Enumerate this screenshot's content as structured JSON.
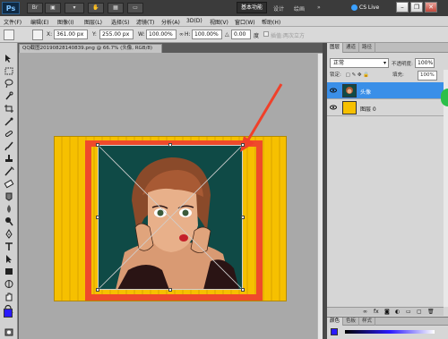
{
  "app": {
    "logo": "Ps",
    "workspace_active": "基本功能",
    "workspace_items": [
      "设计",
      "绘画"
    ],
    "cs_live": "CS Live"
  },
  "menu": [
    "文件(F)",
    "编辑(E)",
    "图像(I)",
    "图层(L)",
    "选择(S)",
    "滤镜(T)",
    "分析(A)",
    "3D(D)",
    "视图(V)",
    "窗口(W)",
    "帮助(H)"
  ],
  "options": {
    "x_label": "X:",
    "x_value": "361.00 px",
    "y_label": "Y:",
    "y_value": "255.00 px",
    "w_label": "W:",
    "w_value": "100.00%",
    "h_label": "H:",
    "h_value": "100.00%",
    "angle_label": "△",
    "angle_value": "0.00",
    "degree": "度",
    "interpolation_label": "插值:两次立方"
  },
  "document": {
    "tab_title": "QQ截图20190828140839.png @ 66.7% (头像, RGB/8)"
  },
  "colors": {
    "foreground": "#2a1aff",
    "background": "#ffffff",
    "artboard_yellow": "#f6c000",
    "frame_red": "#ef4a2b",
    "arrow_red": "#f0402a",
    "layer_selected": "#3a8fe8"
  },
  "layers_panel": {
    "tabs": [
      "图层",
      "通道",
      "路径"
    ],
    "blend_mode": "正常",
    "opacity_label": "不透明度:",
    "opacity_value": "100%",
    "lock_label": "锁定:",
    "fill_label": "填充:",
    "fill_value": "100%",
    "layers": [
      {
        "name": "头像",
        "selected": true
      },
      {
        "name": "图层 0",
        "selected": false
      }
    ]
  },
  "color_panel": {
    "tabs": [
      "颜色",
      "色板",
      "样式"
    ]
  }
}
